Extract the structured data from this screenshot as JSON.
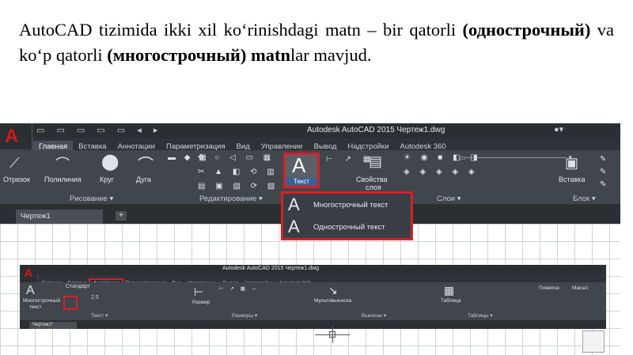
{
  "text": {
    "part1": "AutoCAD tizimida ikki  xil ko‘rinishdagi matn – bir qatorli ",
    "bold1": "(однострочный)",
    "part2": " va ko‘p qatorli ",
    "bold2": "(многострочный) matn",
    "part3": "lar mavjud."
  },
  "shot1": {
    "title": "Autodesk AutoCAD 2015   Чертеж1.dwg",
    "tabs": [
      "Главная",
      "Вставка",
      "Аннотации",
      "Параметризация",
      "Вид",
      "Управление",
      "Вывод",
      "Надстройки",
      "Autodesk 360"
    ],
    "tools": {
      "line": "Отрезок",
      "polyline": "Полилиния",
      "circle": "Круг",
      "arc": "Дуга",
      "text": "Текст",
      "layer_props": "Свойства",
      "layer_props2": "слоя",
      "insert": "Вставка"
    },
    "panels": {
      "draw": "Рисование ▾",
      "modify": "Редактирование ▾",
      "layers": "Слои ▾",
      "block": "Блок ▾"
    },
    "dropdown": [
      "Многострочный текст",
      "Однострочный текст"
    ],
    "file_tab": "Чертеж1"
  },
  "shot2": {
    "title": "Autodesk AutoCAD 2015   Чертеж1.dwg",
    "tabs": [
      "Главная",
      "Вставка",
      "Аннотации",
      "Параметризация",
      "Вид",
      "Управление",
      "Вывод",
      "Надстройки",
      "Autodesk 360"
    ],
    "highlighted_tab": "Аннотации",
    "tools": {
      "mtext": "Многострочный",
      "mtext2": "текст",
      "dim": "Размер",
      "mleader": "Мультивыноска",
      "table": "Таблица",
      "style": "Стандарт",
      "text_height": "2.5",
      "markup": "Пометка",
      "markup2": "Масшт."
    },
    "panels": {
      "text": "Текст ▾",
      "dims": "Размеры ▾",
      "leaders": "Выноски ▾",
      "tables": "Таблицы ▾"
    },
    "file_tab": "Чертеж1*"
  }
}
